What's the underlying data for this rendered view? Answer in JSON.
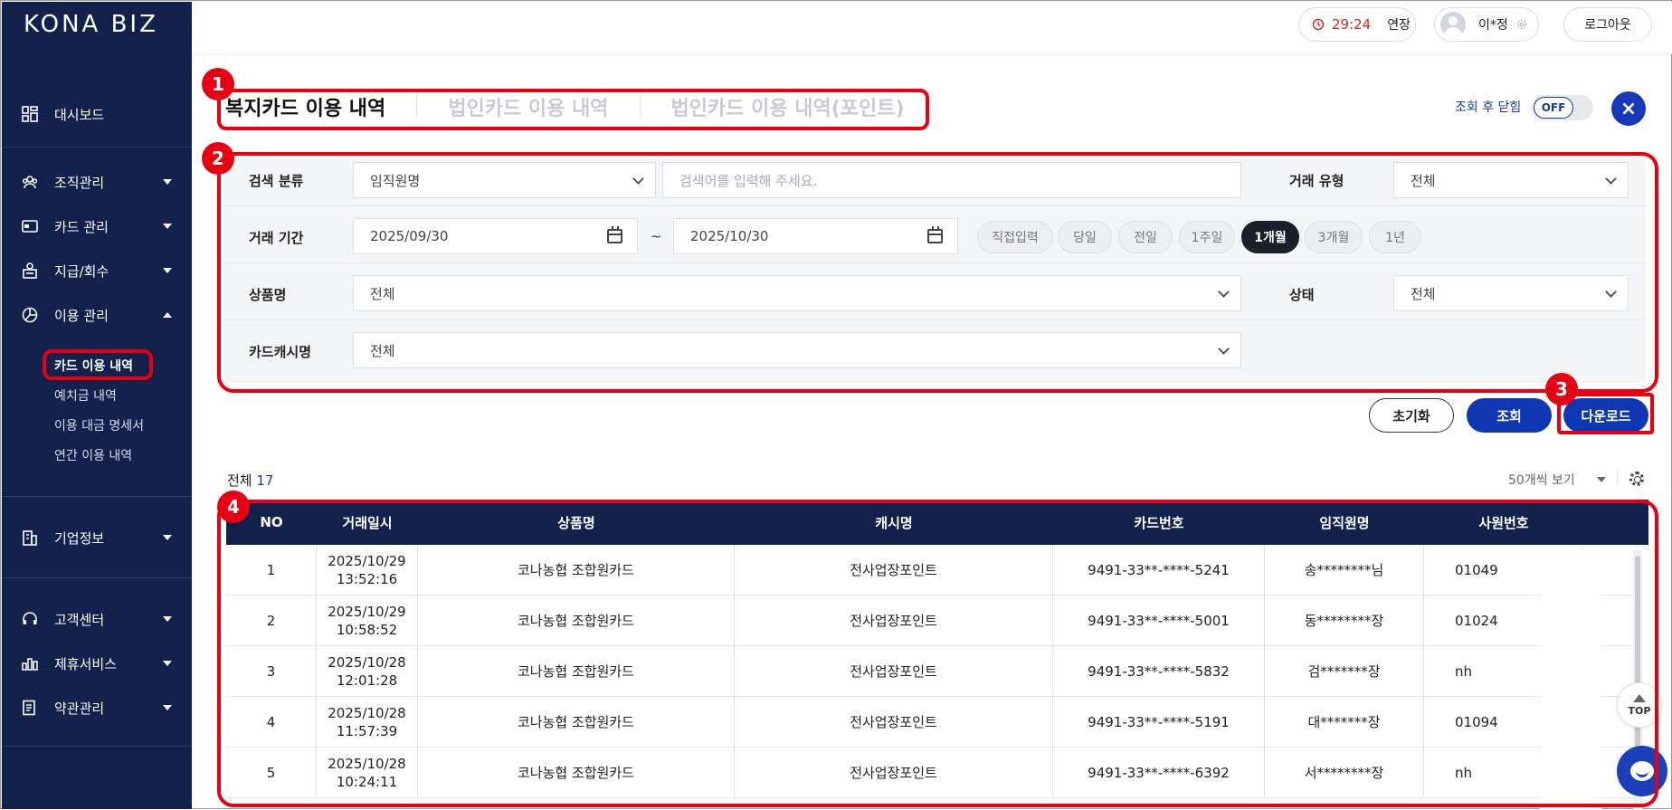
{
  "app": {
    "logo": "KONA BIZ"
  },
  "header": {
    "timer": "29:24",
    "extend": "연장",
    "user_name": "이*정",
    "logout": "로그아웃"
  },
  "sidebar": {
    "items": [
      {
        "label": "대시보드",
        "icon": "dashboard-icon"
      },
      {
        "label": "조직관리",
        "icon": "organization-icon"
      },
      {
        "label": "카드 관리",
        "icon": "card-icon"
      },
      {
        "label": "지급/회수",
        "icon": "payment-icon"
      },
      {
        "label": "이용 관리",
        "icon": "usage-chart-icon"
      },
      {
        "label": "기업정보",
        "icon": "building-icon"
      },
      {
        "label": "고객센터",
        "icon": "headset-icon"
      },
      {
        "label": "제휴서비스",
        "icon": "partnership-icon"
      },
      {
        "label": "약관관리",
        "icon": "document-icon"
      }
    ],
    "sub_items": [
      "카드 이용 내역",
      "예치금 내역",
      "이용 대금 명세서",
      "연간 이용 내역"
    ]
  },
  "tabs": [
    "복지카드 이용 내역",
    "법인카드 이용 내역",
    "법인카드 이용 내역(포인트)"
  ],
  "close_after": {
    "label": "조회 후 닫힘",
    "state": "OFF"
  },
  "close_button": "×",
  "filters": {
    "search_category_label": "검색 분류",
    "search_category_value": "임직원명",
    "search_placeholder": "검색어를 입력해 주세요.",
    "transaction_type_label": "거래 유형",
    "transaction_type_value": "전체",
    "period_label": "거래 기간",
    "date_from": "2025/09/30",
    "date_sep": "~",
    "date_to": "2025/10/30",
    "period_chips": [
      "직접입력",
      "당일",
      "전일",
      "1주일",
      "1개월",
      "3개월",
      "1년"
    ],
    "active_chip": "1개월",
    "product_label": "상품명",
    "product_value": "전체",
    "status_label": "상태",
    "status_value": "전체",
    "cashname_label": "카드캐시명",
    "cashname_value": "전체"
  },
  "actions": {
    "reset": "초기화",
    "search": "조회",
    "download": "다운로드"
  },
  "list": {
    "total_label": "전체",
    "total_count": "17",
    "page_size": "50개씩 보기"
  },
  "table": {
    "columns": [
      "NO",
      "거래일시",
      "상품명",
      "캐시명",
      "카드번호",
      "임직원명",
      "사원번호"
    ],
    "rows": [
      {
        "no": "1",
        "date": "2025/10/29",
        "time": "13:52:16",
        "product": "코나농협 조합원카드",
        "cash": "전사업장포인트",
        "card": "9491-33**-****-5241",
        "name": "송********님",
        "emp": "01049"
      },
      {
        "no": "2",
        "date": "2025/10/29",
        "time": "10:58:52",
        "product": "코나농협 조합원카드",
        "cash": "전사업장포인트",
        "card": "9491-33**-****-5001",
        "name": "동********장",
        "emp": "01024"
      },
      {
        "no": "3",
        "date": "2025/10/28",
        "time": "12:01:28",
        "product": "코나농협 조합원카드",
        "cash": "전사업장포인트",
        "card": "9491-33**-****-5832",
        "name": "검*******장",
        "emp": "nh"
      },
      {
        "no": "4",
        "date": "2025/10/28",
        "time": "11:57:39",
        "product": "코나농협 조합원카드",
        "cash": "전사업장포인트",
        "card": "9491-33**-****-5191",
        "name": "대*******장",
        "emp": "01094"
      },
      {
        "no": "5",
        "date": "2025/10/28",
        "time": "10:24:11",
        "product": "코나농협 조합원카드",
        "cash": "전사업장포인트",
        "card": "9491-33**-****-6392",
        "name": "서********장",
        "emp": "nh"
      }
    ]
  },
  "floating": {
    "top": "TOP"
  },
  "annotations": [
    "1",
    "2",
    "3",
    "4"
  ],
  "colors": {
    "sidebar": "#13224d",
    "primary": "#0f37b4",
    "annotation": "#e60012",
    "timer": "#e5211b"
  }
}
